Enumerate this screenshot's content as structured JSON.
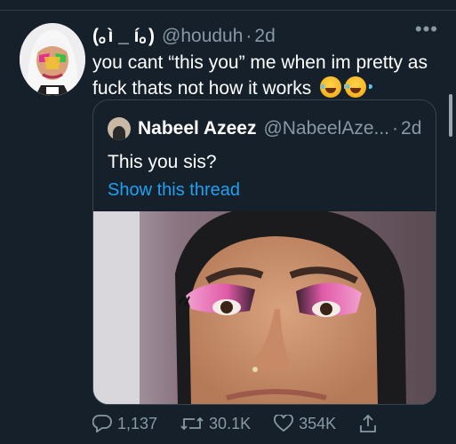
{
  "tweet": {
    "display_name": "(｡ì _ í｡)",
    "handle": "@houduh",
    "dot": "·",
    "time": "2d",
    "more_icon": "more-horizontal-icon",
    "text": "you cant “this you” me when im pretty as fuck thats not how it works",
    "emojis": [
      "face-with-tears-of-joy",
      "face-with-tears-of-joy"
    ]
  },
  "quote": {
    "display_name": "Nabeel Azeez",
    "handle": "@NabeelAze...",
    "dot": "·",
    "time": "2d",
    "text": "This you sis?",
    "thread_link": "Show this thread"
  },
  "actions": {
    "reply_count": "1,137",
    "retweet_count": "30.1K",
    "like_count": "354K",
    "icons": [
      "reply-icon",
      "retweet-icon",
      "like-icon",
      "share-icon"
    ]
  },
  "colors": {
    "background": "#15202b",
    "muted": "#8899a6",
    "link": "#1da1f2",
    "border": "#38444d"
  }
}
